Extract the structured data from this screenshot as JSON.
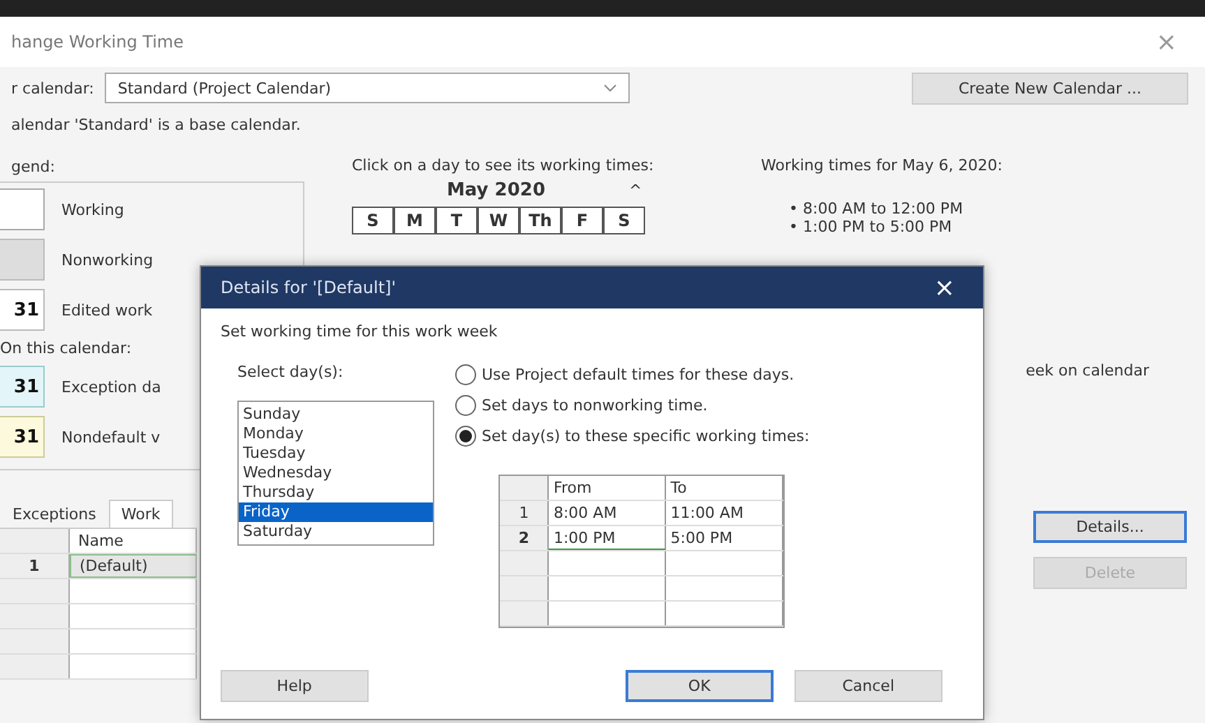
{
  "window": {
    "title": "hange Working Time",
    "close": "×"
  },
  "calendar_select": {
    "label": "r calendar:",
    "value": "Standard (Project Calendar)"
  },
  "create_button": "Create New Calendar ...",
  "base_note": "alendar 'Standard' is a base calendar.",
  "legend": {
    "title": "gend:",
    "items": [
      {
        "kind": "working",
        "label": "Working"
      },
      {
        "kind": "nonworking",
        "label": "Nonworking"
      },
      {
        "kind": "edited",
        "glyph": "31",
        "label": "Edited work"
      }
    ],
    "subtitle": "On this calendar:",
    "calendar_items": [
      {
        "kind": "exception",
        "glyph": "31",
        "label": "Exception da"
      },
      {
        "kind": "nondefault",
        "glyph": "31",
        "label": "Nondefault v"
      }
    ]
  },
  "calendar": {
    "instruction": "Click on a day to see its working times:",
    "month": "May 2020",
    "scroll": "^",
    "days": [
      "S",
      "M",
      "T",
      "W",
      "Th",
      "F",
      "S"
    ]
  },
  "working_times": {
    "title": "Working times for May 6, 2020:",
    "items": [
      "• 8:00 AM to 12:00 PM",
      "• 1:00 PM to 5:00 PM"
    ]
  },
  "week_option": "eek on calendar",
  "tabs": [
    {
      "label": "Exceptions",
      "selected": false
    },
    {
      "label": "Work",
      "selected": true
    }
  ],
  "exceptions_table": {
    "columns": [
      "Name"
    ],
    "rows": [
      {
        "number": "1",
        "name": "(Default)",
        "selected": true
      }
    ]
  },
  "side_buttons": [
    {
      "label": "Details...",
      "disabled": false
    },
    {
      "label": "Delete",
      "disabled": true
    }
  ],
  "details_dialog": {
    "title": "Details for '[Default]'",
    "close": "×",
    "instruction": "Set working time for this work week",
    "days_label": "Select day(s):",
    "days": [
      {
        "label": "Sunday",
        "selected": false
      },
      {
        "label": "Monday",
        "selected": false
      },
      {
        "label": "Tuesday",
        "selected": false
      },
      {
        "label": "Wednesday",
        "selected": false
      },
      {
        "label": "Thursday",
        "selected": false
      },
      {
        "label": "Friday",
        "selected": true
      },
      {
        "label": "Saturday",
        "selected": false
      }
    ],
    "options": [
      {
        "label": "Use Project default times for these days.",
        "selected": false
      },
      {
        "label": "Set days to nonworking time.",
        "selected": false
      },
      {
        "label": "Set day(s) to these specific working times:",
        "selected": true
      }
    ],
    "times": {
      "columns": [
        "From",
        "To"
      ],
      "rows": [
        {
          "number": "1",
          "from": "8:00 AM",
          "to": "11:00 AM",
          "current": false
        },
        {
          "number": "2",
          "from": "1:00 PM",
          "to": "5:00 PM",
          "current": true
        }
      ]
    },
    "buttons": [
      {
        "label": "Help",
        "default": false
      },
      {
        "label": "OK",
        "default": true
      },
      {
        "label": "Cancel",
        "default": false
      }
    ]
  }
}
